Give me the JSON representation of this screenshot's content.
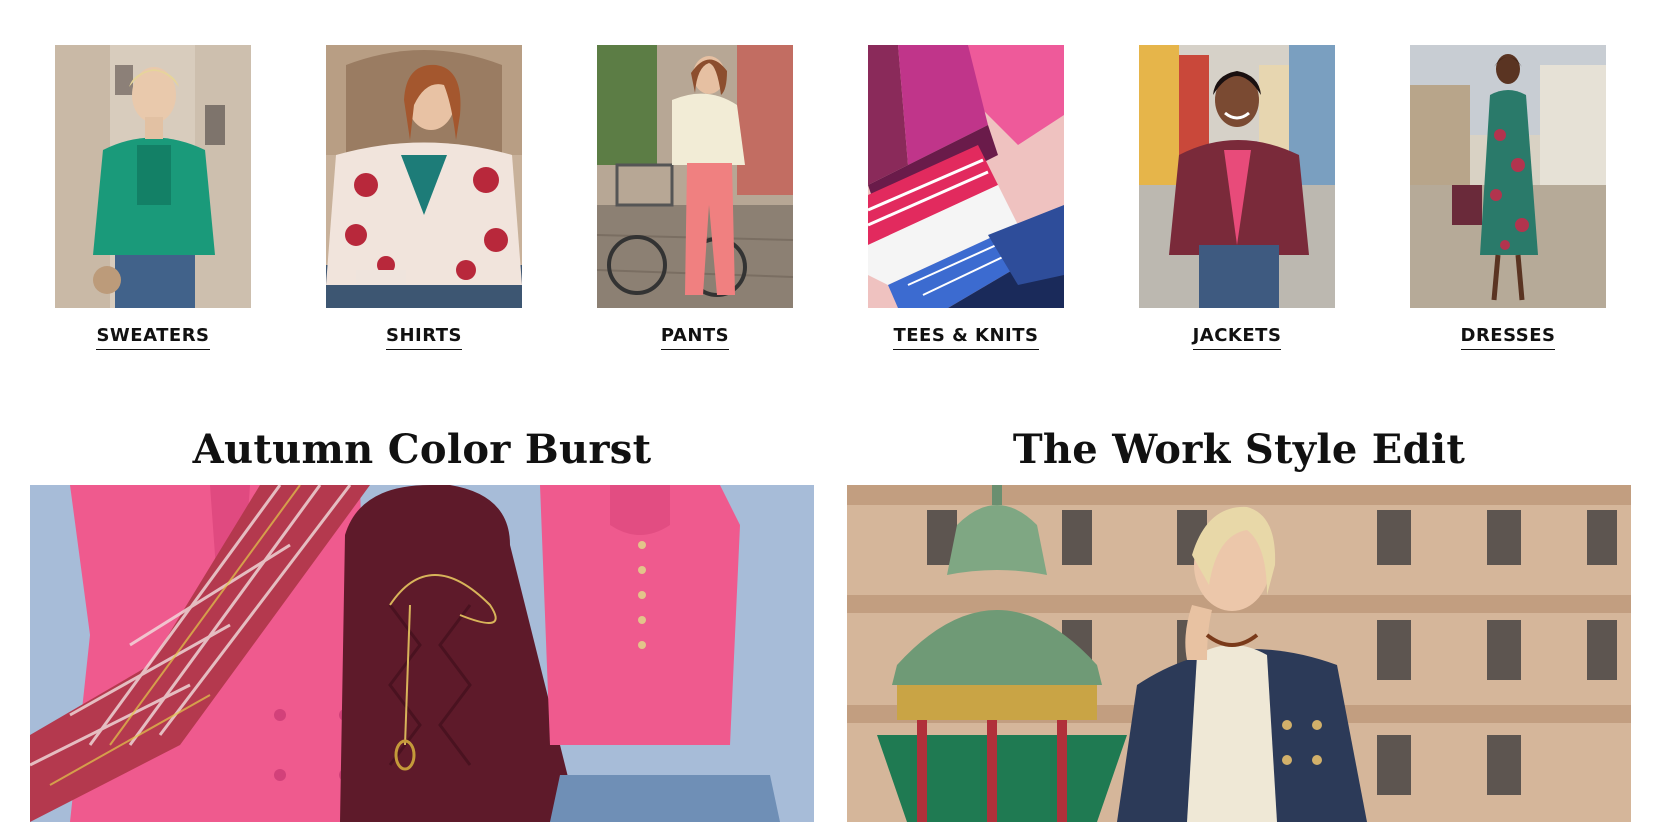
{
  "categories": [
    {
      "label": "SWEATERS",
      "image_alt": "Woman in green cardigan"
    },
    {
      "label": "SHIRTS",
      "image_alt": "Woman in floral shirt"
    },
    {
      "label": "PANTS",
      "image_alt": "Woman with bicycle in pink pants"
    },
    {
      "label": "TEES & KNITS",
      "image_alt": "Stack of colorful folded tees"
    },
    {
      "label": "JACKETS",
      "image_alt": "Woman in burgundy quilted jacket"
    },
    {
      "label": "DRESSES",
      "image_alt": "Woman in printed maxi dress"
    }
  ],
  "features": [
    {
      "title": "Autumn Color Burst",
      "image_alt": "Flat lay of pink coat, plaid scarf, burgundy sweater"
    },
    {
      "title": "The Work Style Edit",
      "image_alt": "Woman in denim blazer in city square"
    }
  ],
  "colors": {
    "text": "#111111",
    "background": "#ffffff"
  }
}
